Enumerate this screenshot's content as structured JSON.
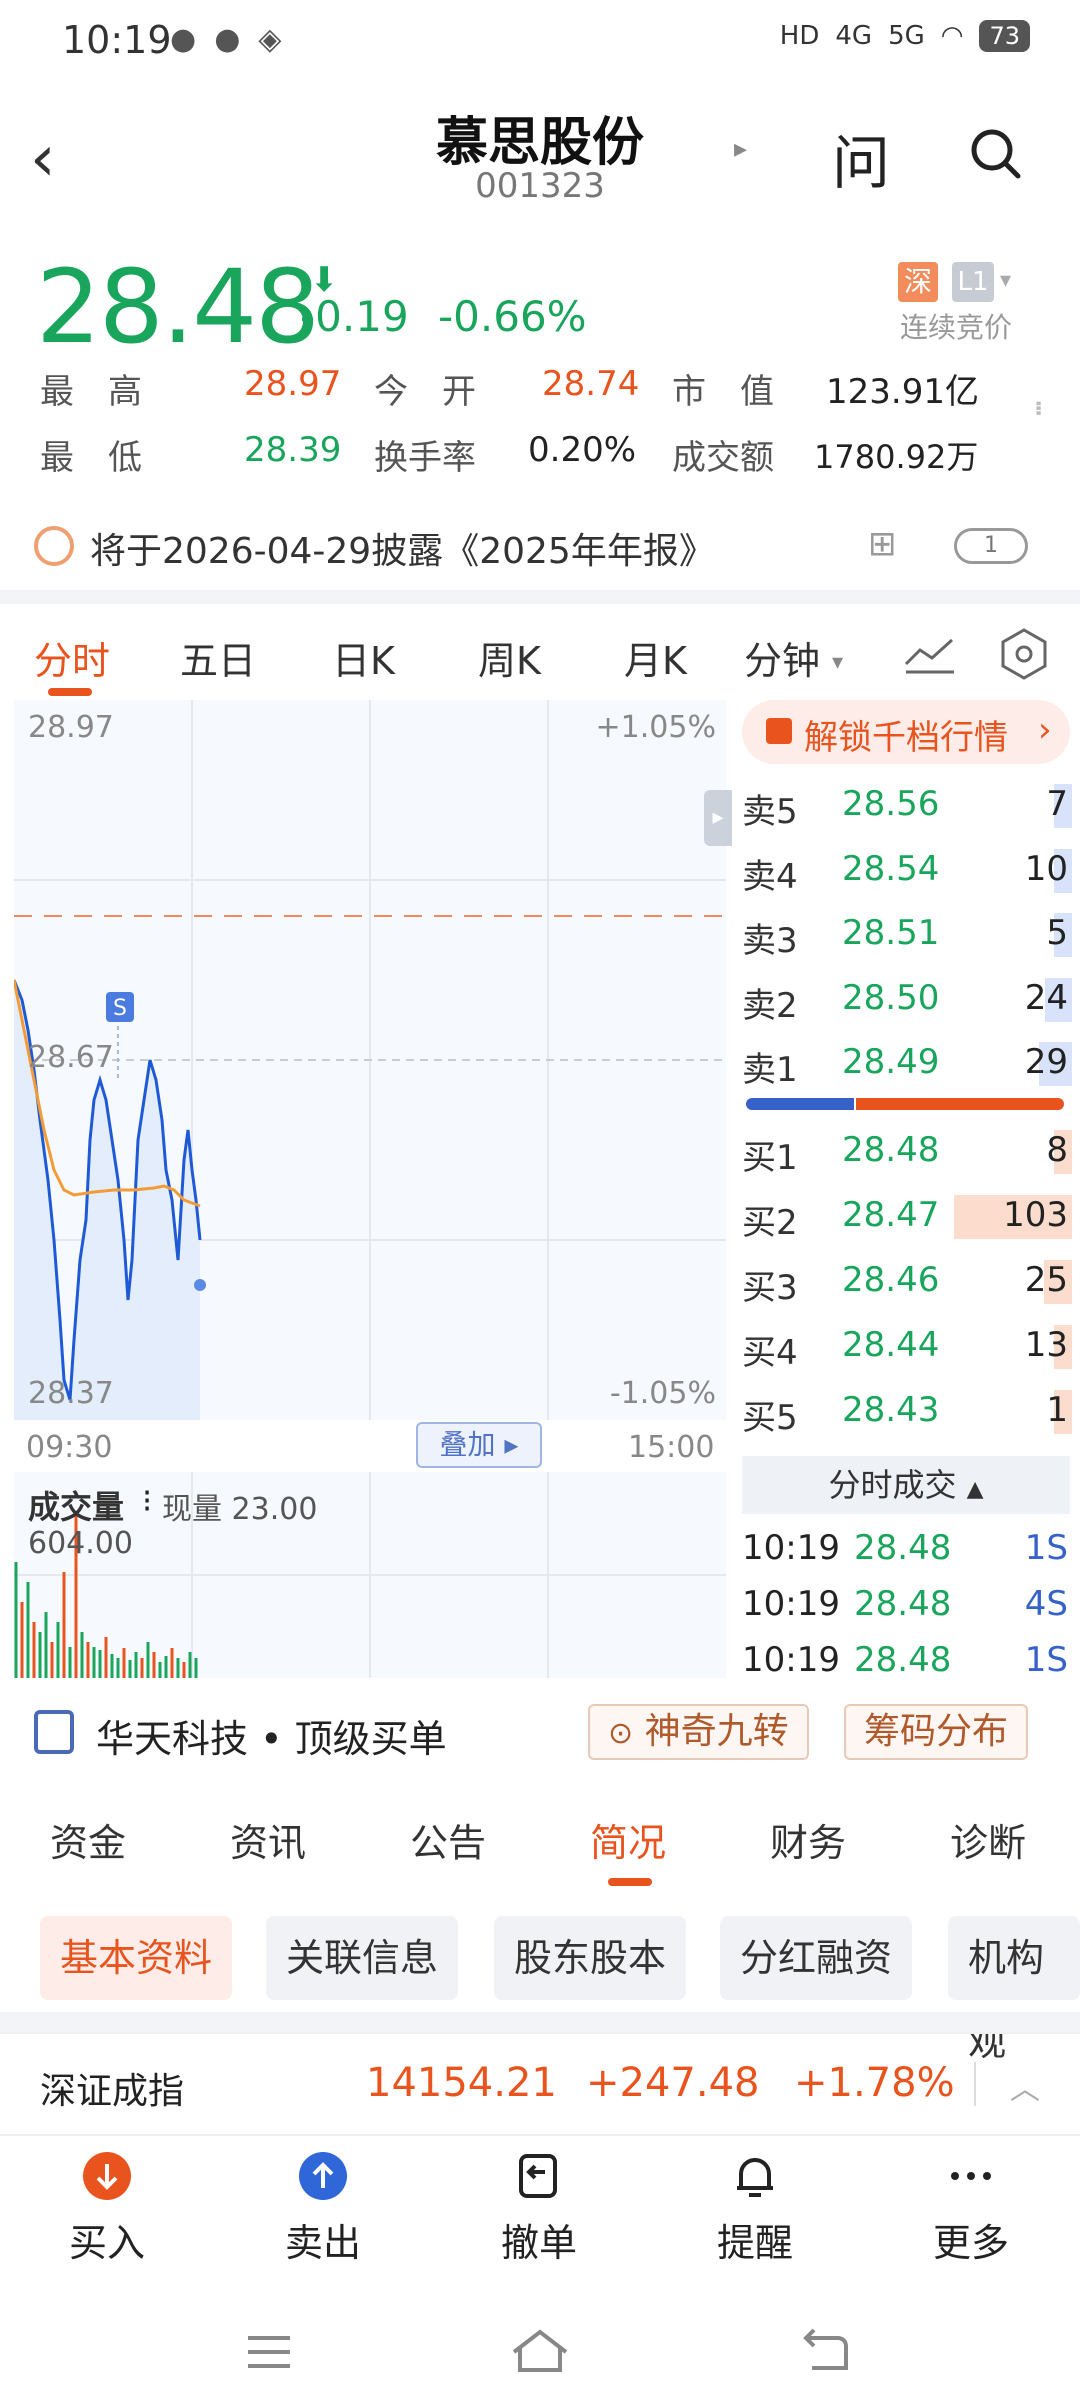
{
  "status": {
    "time": "10:19",
    "battery": "73",
    "net1": "HD",
    "net2": "4G",
    "net3": "5G"
  },
  "header": {
    "title": "慕思股份",
    "code": "001323",
    "ask": "问"
  },
  "quote": {
    "price": "28.48",
    "change": "-0.19",
    "change_pct": "-0.66%",
    "exchange_tag": "深",
    "level_tag": "L1",
    "mode": "连续竞价",
    "high_label": "最　高",
    "high": "28.97",
    "open_label": "今　开",
    "open": "28.74",
    "mcap_label": "市　值",
    "mcap": "123.91亿",
    "low_label": "最　低",
    "low": "28.39",
    "turnover_label": "换手率",
    "turnover": "0.20%",
    "amount_label": "成交额",
    "amount": "1780.92万"
  },
  "disclosure": {
    "text": "将于2026-04-29披露《2025年年报》",
    "badge": "1"
  },
  "tabs": [
    "分时",
    "五日",
    "日K",
    "周K",
    "月K",
    "分钟"
  ],
  "chart": {
    "y_top": "28.97",
    "y_mid": "28.67",
    "y_bottom": "28.37",
    "pct_top": "+1.05%",
    "pct_bottom": "-1.05%",
    "time_start": "09:30",
    "time_end": "15:00",
    "overlay": "叠加",
    "marker": "S",
    "volume_label": "成交量",
    "volume_now": "现量 23.00",
    "volume_max": "604.00"
  },
  "orderbook": {
    "unlock": "解锁千档行情",
    "asks": [
      {
        "label": "卖5",
        "price": "28.56",
        "vol": "7",
        "share": 0.07
      },
      {
        "label": "卖4",
        "price": "28.54",
        "vol": "10",
        "share": 0.1
      },
      {
        "label": "卖3",
        "price": "28.51",
        "vol": "5",
        "share": 0.05
      },
      {
        "label": "卖2",
        "price": "28.50",
        "vol": "24",
        "share": 0.23
      },
      {
        "label": "卖1",
        "price": "28.49",
        "vol": "29",
        "share": 0.28
      }
    ],
    "bids": [
      {
        "label": "买1",
        "price": "28.48",
        "vol": "8",
        "share": 0.08
      },
      {
        "label": "买2",
        "price": "28.47",
        "vol": "103",
        "share": 1.0
      },
      {
        "label": "买3",
        "price": "28.46",
        "vol": "25",
        "share": 0.24
      },
      {
        "label": "买4",
        "price": "28.44",
        "vol": "13",
        "share": 0.13
      },
      {
        "label": "买5",
        "price": "28.43",
        "vol": "1",
        "share": 0.02
      }
    ],
    "ticks_title": "分时成交",
    "ticks": [
      {
        "time": "10:19",
        "price": "28.48",
        "vol": "1S"
      },
      {
        "time": "10:19",
        "price": "28.48",
        "vol": "4S"
      },
      {
        "time": "10:19",
        "price": "28.48",
        "vol": "1S"
      }
    ]
  },
  "strip": {
    "broker": "华天科技",
    "dot": "•",
    "label": "顶级买单",
    "chip1": "神奇九转",
    "chip2": "筹码分布"
  },
  "subtabs": [
    "资金",
    "资讯",
    "公告",
    "简况",
    "财务",
    "诊断"
  ],
  "pills": [
    "基本资料",
    "关联信息",
    "股东股本",
    "分红融资",
    "机构观"
  ],
  "index": {
    "name": "深证成指",
    "value": "14154.21",
    "change": "+247.48",
    "pct": "+1.78%"
  },
  "actions": [
    "买入",
    "卖出",
    "撤单",
    "提醒",
    "更多"
  ],
  "colors": {
    "up": "#e8531e",
    "down": "#19a55c",
    "accent": "#e8531e",
    "ask_bar": "#d8e3fb",
    "bid_bar": "#fbdccd"
  }
}
